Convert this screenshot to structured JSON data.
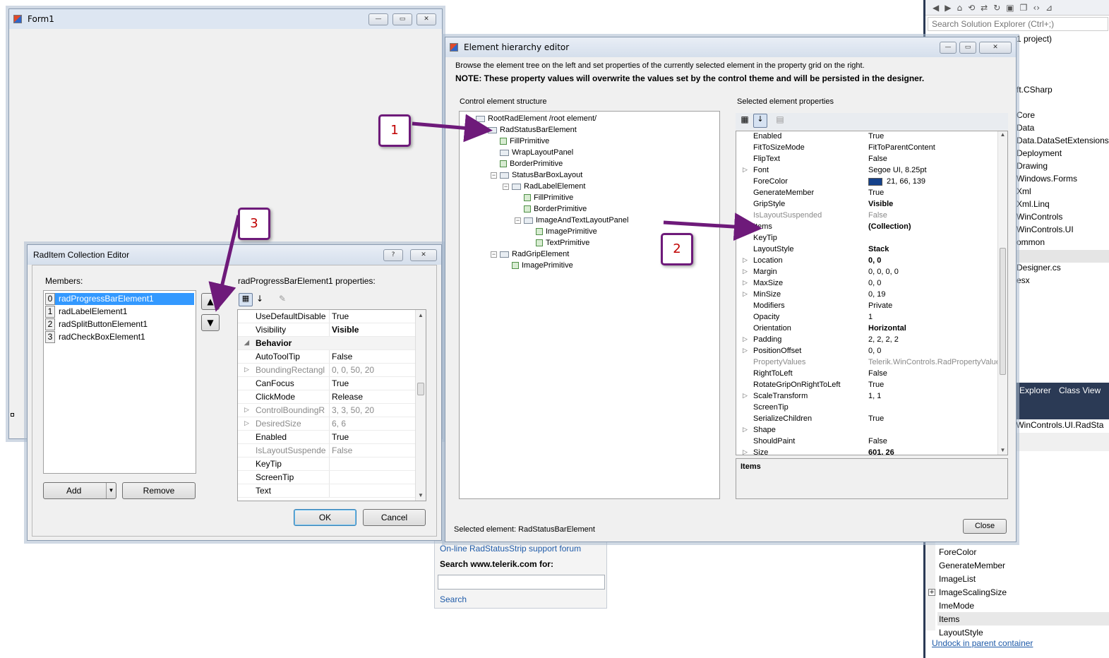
{
  "form1": {
    "title": "Form1"
  },
  "vs": {
    "search_placeholder": "Search Solution Explorer (Ctrl+;)",
    "tree": [
      "1 project)",
      "ft.CSharp",
      "Core",
      "Data",
      "Data.DataSetExtensions",
      "Deployment",
      "Drawing",
      "Windows.Forms",
      "Xml",
      "Xml.Linq",
      "WinControls",
      "WinControls.UI",
      "ommon",
      "Designer.cs",
      "esx"
    ],
    "tabs": [
      "n Explorer",
      "Class View"
    ],
    "object_label": "k.WinControls.UI.RadSta",
    "props": [
      "ForeColor",
      "GenerateMember",
      "ImageList",
      "ImageScalingSize",
      "ImeMode",
      "Items",
      "LayoutStyle"
    ],
    "undock": "Undock in parent container"
  },
  "help_panel": {
    "forum_link": "On-line RadStatusStrip support forum",
    "search_label": "Search www.telerik.com for:",
    "search_button": "Search",
    "search_value": ""
  },
  "ehe": {
    "title": "Element hierarchy editor",
    "desc": "Browse the element tree on the left and set properties of the currently selected element in the property grid on the right.",
    "note": "NOTE: These property values will overwrite the values set by the control theme and will be persisted in the designer.",
    "tree_label": "Control element structure",
    "props_label": "Selected element properties",
    "tree": [
      {
        "text": "RootRadElement /root element/",
        "depth": 0,
        "exp": "",
        "icon": "box"
      },
      {
        "text": "RadStatusBarElement",
        "depth": 1,
        "exp": "−",
        "icon": "box"
      },
      {
        "text": "FillPrimitive",
        "depth": 2,
        "exp": "",
        "icon": "prim"
      },
      {
        "text": "WrapLayoutPanel",
        "depth": 2,
        "exp": "",
        "icon": "box"
      },
      {
        "text": "BorderPrimitive",
        "depth": 2,
        "exp": "",
        "icon": "prim"
      },
      {
        "text": "StatusBarBoxLayout",
        "depth": 2,
        "exp": "−",
        "icon": "box"
      },
      {
        "text": "RadLabelElement",
        "depth": 3,
        "exp": "−",
        "icon": "box"
      },
      {
        "text": "FillPrimitive",
        "depth": 4,
        "exp": "",
        "icon": "prim"
      },
      {
        "text": "BorderPrimitive",
        "depth": 4,
        "exp": "",
        "icon": "prim"
      },
      {
        "text": "ImageAndTextLayoutPanel",
        "depth": 4,
        "exp": "−",
        "icon": "box"
      },
      {
        "text": "ImagePrimitive",
        "depth": 5,
        "exp": "",
        "icon": "prim"
      },
      {
        "text": "TextPrimitive",
        "depth": 5,
        "exp": "",
        "icon": "prim"
      },
      {
        "text": "RadGripElement",
        "depth": 2,
        "exp": "−",
        "icon": "box"
      },
      {
        "text": "ImagePrimitive",
        "depth": 3,
        "exp": "",
        "icon": "prim"
      }
    ],
    "props": [
      {
        "n": "Enabled",
        "v": "True",
        "exp": "",
        "style": ""
      },
      {
        "n": "FitToSizeMode",
        "v": "FitToParentContent",
        "exp": "",
        "style": ""
      },
      {
        "n": "FlipText",
        "v": "False",
        "exp": "",
        "style": ""
      },
      {
        "n": "Font",
        "v": "Segoe UI, 8.25pt",
        "exp": "▷",
        "style": ""
      },
      {
        "n": "ForeColor",
        "v": "21, 66, 139",
        "exp": "",
        "style": "color",
        "swatch": "#15428b"
      },
      {
        "n": "GenerateMember",
        "v": "True",
        "exp": "",
        "style": ""
      },
      {
        "n": "GripStyle",
        "v": "Visible",
        "exp": "",
        "style": "bold"
      },
      {
        "n": "IsLayoutSuspended",
        "v": "False",
        "exp": "",
        "style": "gray"
      },
      {
        "n": "Items",
        "v": "(Collection)",
        "exp": "",
        "style": "bold"
      },
      {
        "n": "KeyTip",
        "v": "",
        "exp": "",
        "style": ""
      },
      {
        "n": "LayoutStyle",
        "v": "Stack",
        "exp": "",
        "style": "bold"
      },
      {
        "n": "Location",
        "v": "0, 0",
        "exp": "▷",
        "style": "bold"
      },
      {
        "n": "Margin",
        "v": "0, 0, 0, 0",
        "exp": "▷",
        "style": ""
      },
      {
        "n": "MaxSize",
        "v": "0, 0",
        "exp": "▷",
        "style": ""
      },
      {
        "n": "MinSize",
        "v": "0, 19",
        "exp": "▷",
        "style": ""
      },
      {
        "n": "Modifiers",
        "v": "Private",
        "exp": "",
        "style": ""
      },
      {
        "n": "Opacity",
        "v": "1",
        "exp": "",
        "style": ""
      },
      {
        "n": "Orientation",
        "v": "Horizontal",
        "exp": "",
        "style": "bold"
      },
      {
        "n": "Padding",
        "v": "2, 2, 2, 2",
        "exp": "▷",
        "style": ""
      },
      {
        "n": "PositionOffset",
        "v": "0, 0",
        "exp": "▷",
        "style": ""
      },
      {
        "n": "PropertyValues",
        "v": "Telerik.WinControls.RadPropertyValue",
        "exp": "",
        "style": "gray"
      },
      {
        "n": "RightToLeft",
        "v": "False",
        "exp": "",
        "style": ""
      },
      {
        "n": "RotateGripOnRightToLeft",
        "v": "True",
        "exp": "",
        "style": ""
      },
      {
        "n": "ScaleTransform",
        "v": "1, 1",
        "exp": "▷",
        "style": ""
      },
      {
        "n": "ScreenTip",
        "v": "",
        "exp": "",
        "style": ""
      },
      {
        "n": "SerializeChildren",
        "v": "True",
        "exp": "",
        "style": ""
      },
      {
        "n": "Shape",
        "v": "",
        "exp": "▷",
        "style": ""
      },
      {
        "n": "ShouldPaint",
        "v": "False",
        "exp": "",
        "style": ""
      },
      {
        "n": "Size",
        "v": "601, 26",
        "exp": "▷",
        "style": "bold"
      }
    ],
    "desc_title": "Items",
    "selected": "Selected element: RadStatusBarElement",
    "close": "Close"
  },
  "rce": {
    "title": "RadItem Collection Editor",
    "help": "?",
    "members_label": "Members:",
    "members": [
      {
        "idx": "0",
        "text": "radProgressBarElement1"
      },
      {
        "idx": "1",
        "text": "radLabelElement1"
      },
      {
        "idx": "2",
        "text": "radSplitButtonElement1"
      },
      {
        "idx": "3",
        "text": "radCheckBoxElement1"
      }
    ],
    "props_label": "radProgressBarElement1 properties:",
    "props": [
      {
        "n": "UseDefaultDisablec",
        "v": "True",
        "exp": "",
        "style": ""
      },
      {
        "n": "Visibility",
        "v": "Visible",
        "exp": "",
        "style": "boldv"
      },
      {
        "n": "Behavior",
        "v": "",
        "exp": "◢",
        "style": "cat"
      },
      {
        "n": "AutoToolTip",
        "v": "False",
        "exp": "",
        "style": ""
      },
      {
        "n": "BoundingRectangl",
        "v": "0, 0, 50, 20",
        "exp": "▷",
        "style": "gray"
      },
      {
        "n": "CanFocus",
        "v": "True",
        "exp": "",
        "style": ""
      },
      {
        "n": "ClickMode",
        "v": "Release",
        "exp": "",
        "style": ""
      },
      {
        "n": "ControlBoundingR",
        "v": "3, 3, 50, 20",
        "exp": "▷",
        "style": "gray"
      },
      {
        "n": "DesiredSize",
        "v": "6, 6",
        "exp": "▷",
        "style": "gray"
      },
      {
        "n": "Enabled",
        "v": "True",
        "exp": "",
        "style": ""
      },
      {
        "n": "IsLayoutSuspendec",
        "v": "False",
        "exp": "",
        "style": "gray"
      },
      {
        "n": "KeyTip",
        "v": "",
        "exp": "",
        "style": ""
      },
      {
        "n": "ScreenTip",
        "v": "",
        "exp": "",
        "style": ""
      },
      {
        "n": "Text",
        "v": "",
        "exp": "",
        "style": ""
      }
    ],
    "add": "Add",
    "remove": "Remove",
    "ok": "OK",
    "cancel": "Cancel"
  },
  "callouts": [
    "1",
    "2",
    "3"
  ],
  "colors": {
    "accent": "#3399ff",
    "callout": "#6e1a7a",
    "callout_text": "#c00000",
    "link": "#1e5aa8"
  }
}
